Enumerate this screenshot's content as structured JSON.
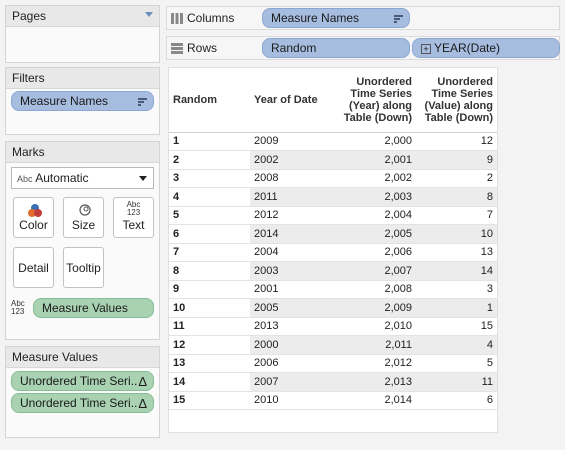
{
  "pages": {
    "title": "Pages"
  },
  "filters": {
    "title": "Filters",
    "pill": "Measure Names"
  },
  "marks": {
    "title": "Marks",
    "mark_type": "Automatic",
    "mark_type_prefix": "Abc",
    "cards": {
      "color": "Color",
      "size": "Size",
      "text": "Text",
      "detail": "Detail",
      "tooltip": "Tooltip"
    },
    "text_icon": "Abc\n123",
    "values_pill": "Measure Values"
  },
  "measure_values": {
    "title": "Measure Values",
    "items": [
      "Unordered Time Seri..",
      "Unordered Time Seri.."
    ],
    "delta": "Δ"
  },
  "columns": {
    "label": "Columns",
    "pill": "Measure Names"
  },
  "rows": {
    "label": "Rows",
    "pills": [
      "Random",
      "YEAR(Date)"
    ],
    "expand": "+"
  },
  "table": {
    "headers": [
      "Random",
      "Year of Date",
      "Unordered Time Series (Year) along Table (Down)",
      "Unordered Time Series (Value) along Table (Down)"
    ],
    "rows": [
      [
        "1",
        "2009",
        "2,000",
        "12"
      ],
      [
        "2",
        "2002",
        "2,001",
        "9"
      ],
      [
        "3",
        "2008",
        "2,002",
        "2"
      ],
      [
        "4",
        "2011",
        "2,003",
        "8"
      ],
      [
        "5",
        "2012",
        "2,004",
        "7"
      ],
      [
        "6",
        "2014",
        "2,005",
        "10"
      ],
      [
        "7",
        "2004",
        "2,006",
        "13"
      ],
      [
        "8",
        "2003",
        "2,007",
        "14"
      ],
      [
        "9",
        "2001",
        "2,008",
        "3"
      ],
      [
        "10",
        "2005",
        "2,009",
        "1"
      ],
      [
        "11",
        "2013",
        "2,010",
        "15"
      ],
      [
        "12",
        "2000",
        "2,011",
        "4"
      ],
      [
        "13",
        "2006",
        "2,012",
        "5"
      ],
      [
        "14",
        "2007",
        "2,013",
        "11"
      ],
      [
        "15",
        "2010",
        "2,014",
        "6"
      ]
    ]
  }
}
